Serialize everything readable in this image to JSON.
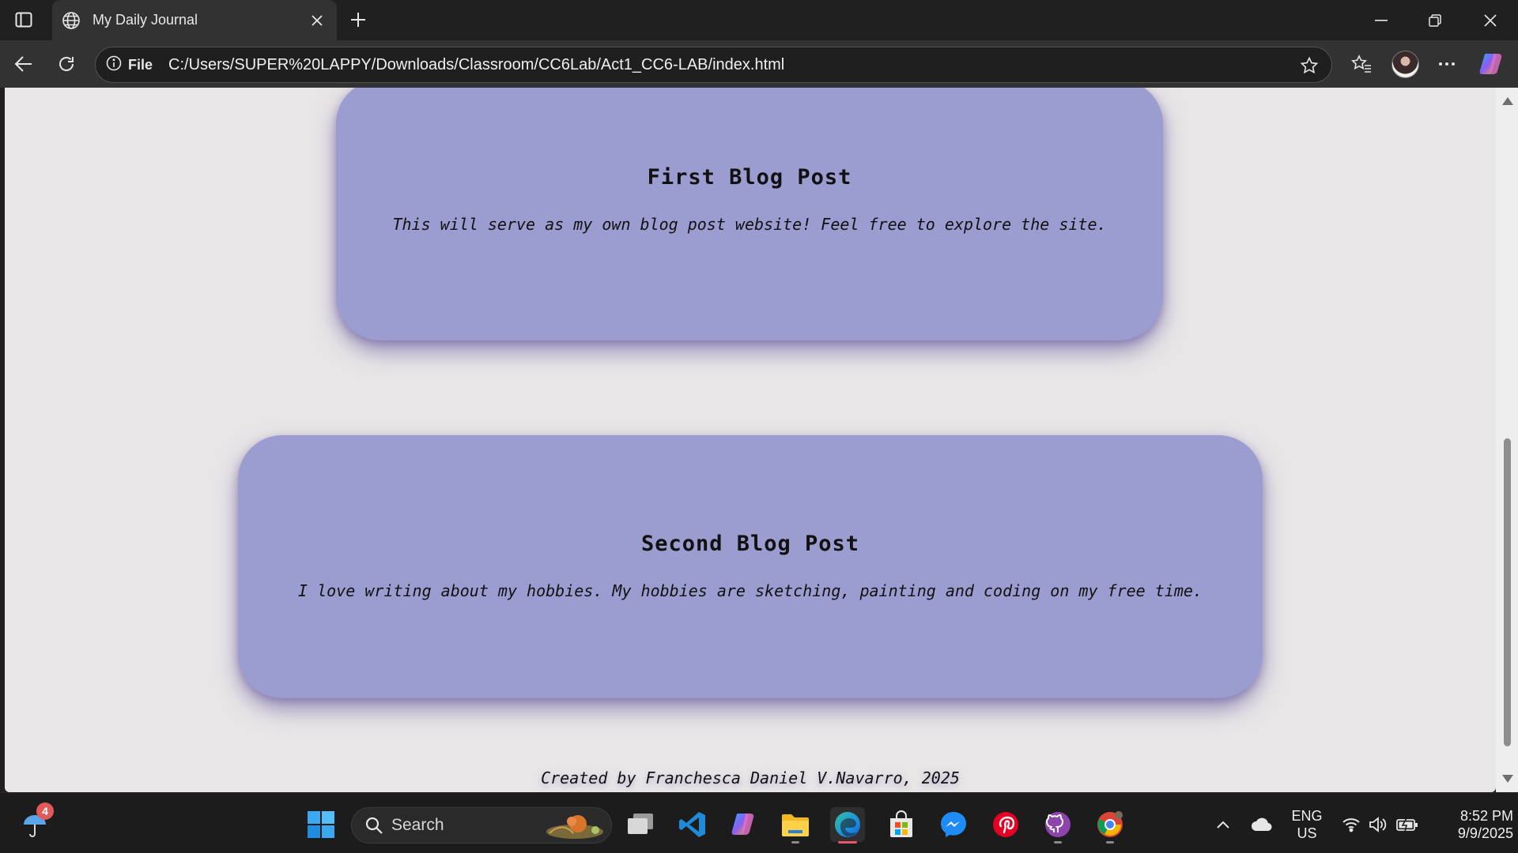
{
  "browser": {
    "tab": {
      "title": "My Daily Journal",
      "favicon": "globe-icon"
    },
    "address": {
      "site_info_label": "File",
      "url": "C:/Users/SUPER%20LAPPY/Downloads/Classroom/CC6Lab/Act1_CC6-LAB/index.html"
    }
  },
  "page": {
    "posts": [
      {
        "title": "First Blog Post",
        "body": "This will serve as my own blog post website! Feel free to explore the site."
      },
      {
        "title": "Second Blog Post",
        "body": "I love writing about my hobbies. My hobbies are sketching, painting and coding on my free time."
      }
    ],
    "footer": "Created by Franchesca Daniel V.Navarro, 2025",
    "colors": {
      "background": "#e9e6e7",
      "card": "#9b9ccf",
      "text": "#111111"
    }
  },
  "taskbar": {
    "weather_badge": "4",
    "search_label": "Search",
    "apps": [
      "start-icon",
      "task-view-icon",
      "vscode-icon",
      "copilot-icon",
      "file-explorer-icon",
      "edge-icon",
      "store-icon",
      "messenger-icon",
      "pinterest-icon",
      "github-icon",
      "chrome-icon"
    ],
    "language": {
      "line1": "ENG",
      "line2": "US"
    },
    "clock": {
      "time": "8:52 PM",
      "date": "9/9/2025"
    }
  }
}
